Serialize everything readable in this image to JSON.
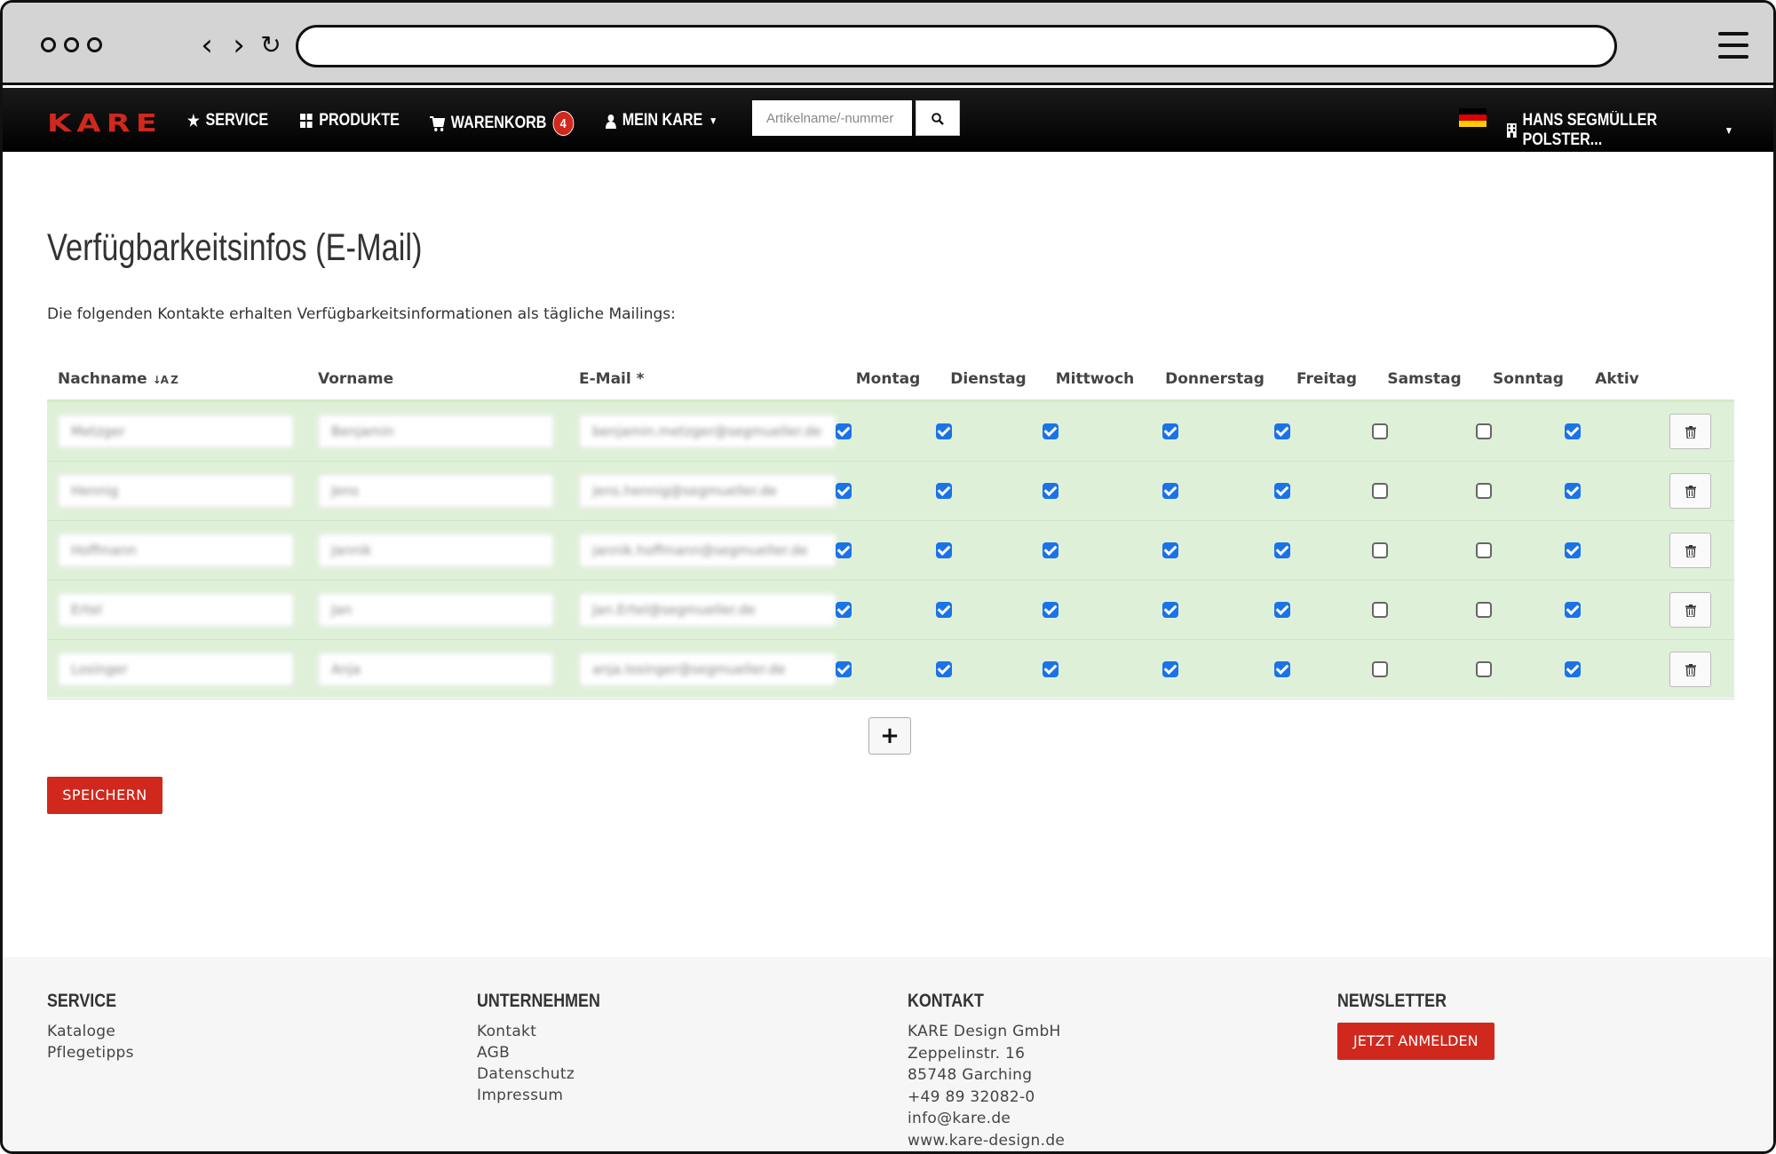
{
  "nav": {
    "logo": "KARE",
    "service": "SERVICE",
    "produkte": "PRODUKTE",
    "warenkorb": "WARENKORB",
    "cart_count": "4",
    "mein_kare": "MEIN KARE",
    "search_placeholder": "Artikelname/-nummer",
    "account": "HANS SEGMÜLLER POLSTER...",
    "icons": {
      "service": "star-icon",
      "produkte": "grid-icon",
      "warenkorb": "cart-icon",
      "mein_kare": "user-icon",
      "search": "search-icon",
      "account": "building-icon"
    }
  },
  "page": {
    "title": "Verfügbarkeitsinfos (E-Mail)",
    "intro": "Die folgenden Kontakte erhalten Verfügbarkeitsinformationen als tägliche Mailings:"
  },
  "table": {
    "headers": [
      "Nachname",
      "Vorname",
      "E-Mail *",
      "Montag",
      "Dienstag",
      "Mittwoch",
      "Donnerstag",
      "Freitag",
      "Samstag",
      "Sonntag",
      "Aktiv"
    ],
    "sort_indicator": "↓A Z",
    "rows": [
      {
        "nachname": "Metzger",
        "vorname": "Benjamin",
        "email": "benjamin.metzger@segmueller.de",
        "days": [
          true,
          true,
          true,
          true,
          true,
          false,
          false
        ],
        "aktiv": true
      },
      {
        "nachname": "Hennig",
        "vorname": "Jens",
        "email": "jens.hennig@segmueller.de",
        "days": [
          true,
          true,
          true,
          true,
          true,
          false,
          false
        ],
        "aktiv": true
      },
      {
        "nachname": "Hoffmann",
        "vorname": "Jannik",
        "email": "jannik.hoffmann@segmueller.de",
        "days": [
          true,
          true,
          true,
          true,
          true,
          false,
          false
        ],
        "aktiv": true
      },
      {
        "nachname": "Ertel",
        "vorname": "Jan",
        "email": "Jan.Ertel@segmueller.de",
        "days": [
          true,
          true,
          true,
          true,
          true,
          false,
          false
        ],
        "aktiv": true
      },
      {
        "nachname": "Losinger",
        "vorname": "Anja",
        "email": "anja.losinger@segmueller.de",
        "days": [
          true,
          true,
          true,
          true,
          true,
          false,
          false
        ],
        "aktiv": true
      }
    ]
  },
  "buttons": {
    "add": "+",
    "save": "SPEICHERN"
  },
  "footer": {
    "service": {
      "title": "SERVICE",
      "links": [
        "Kataloge",
        "Pflegetipps"
      ]
    },
    "unternehmen": {
      "title": "UNTERNEHMEN",
      "links": [
        "Kontakt",
        "AGB",
        "Datenschutz",
        "Impressum"
      ]
    },
    "kontakt": {
      "title": "KONTAKT",
      "lines": [
        "KARE Design GmbH",
        "Zeppelinstr. 16",
        "85748 Garching",
        "+49 89 32082-0",
        "info@kare.de",
        "www.kare-design.de"
      ]
    },
    "newsletter": {
      "title": "NEWSLETTER",
      "button": "JETZT ANMELDEN"
    }
  },
  "colors": {
    "brand_red": "#d0281d",
    "row_green": "#dff0d8",
    "checkbox_blue": "#1a73e8"
  }
}
